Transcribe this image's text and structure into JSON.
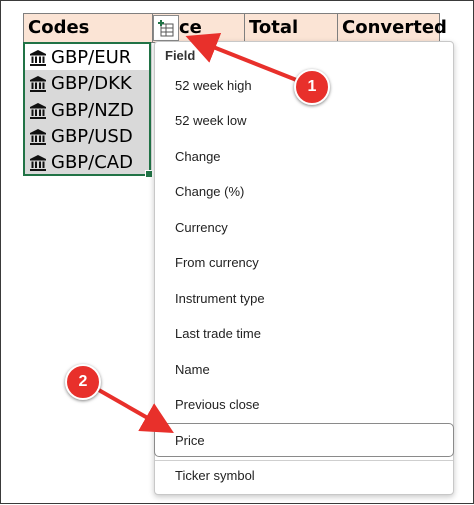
{
  "sheet": {
    "headers": [
      "Codes",
      "ce",
      "Total",
      "Converted"
    ],
    "codes": [
      "GBP/EUR",
      "GBP/DKK",
      "GBP/NZD",
      "GBP/USD",
      "GBP/CAD"
    ]
  },
  "insert_data_button": {
    "icon": "insert-data-icon"
  },
  "dropdown": {
    "header": "Field",
    "items": [
      "52 week high",
      "52 week low",
      "Change",
      "Change (%)",
      "Currency",
      "From currency",
      "Instrument type",
      "Last trade time",
      "Name",
      "Previous close",
      "Price",
      "Ticker symbol"
    ],
    "hovered_item": "Price"
  },
  "callouts": {
    "one": "1",
    "two": "2"
  },
  "colors": {
    "header_fill": "#fbe4d5",
    "selection_border": "#217346",
    "callout": "#e8302b"
  }
}
